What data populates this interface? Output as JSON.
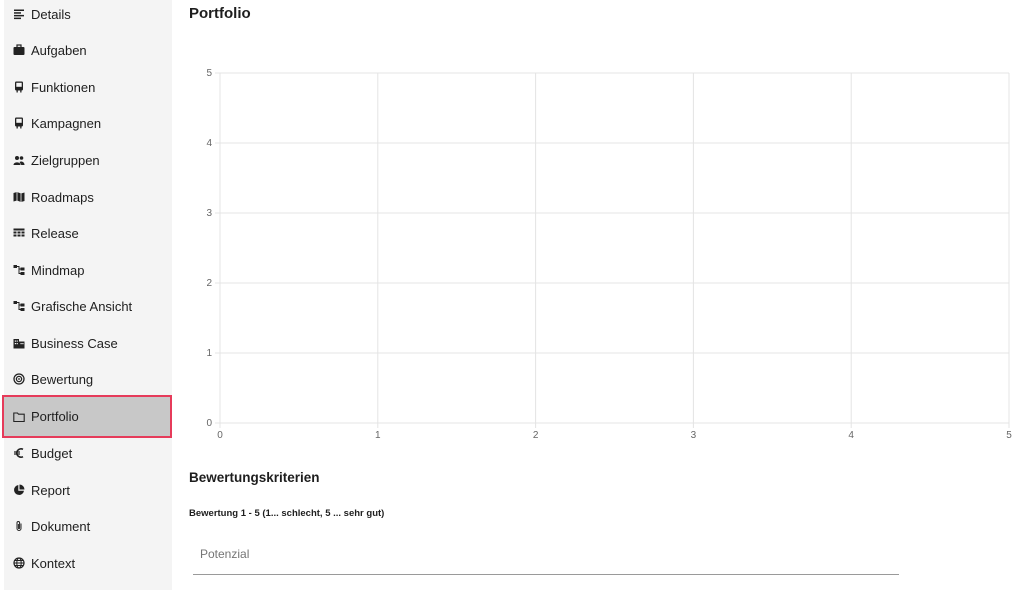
{
  "sidebar": {
    "items": [
      {
        "label": "Details",
        "icon": "details-icon"
      },
      {
        "label": "Aufgaben",
        "icon": "briefcase-icon"
      },
      {
        "label": "Funktionen",
        "icon": "device-icon"
      },
      {
        "label": "Kampagnen",
        "icon": "device-icon"
      },
      {
        "label": "Zielgruppen",
        "icon": "people-icon"
      },
      {
        "label": "Roadmaps",
        "icon": "map-icon"
      },
      {
        "label": "Release",
        "icon": "release-icon"
      },
      {
        "label": "Mindmap",
        "icon": "mindmap-icon"
      },
      {
        "label": "Grafische Ansicht",
        "icon": "mindmap-icon"
      },
      {
        "label": "Business Case",
        "icon": "building-icon"
      },
      {
        "label": "Bewertung",
        "icon": "target-icon"
      },
      {
        "label": "Portfolio",
        "icon": "folder-icon"
      },
      {
        "label": "Budget",
        "icon": "euro-icon"
      },
      {
        "label": "Report",
        "icon": "pie-chart-icon"
      },
      {
        "label": "Dokument",
        "icon": "paperclip-icon"
      },
      {
        "label": "Kontext",
        "icon": "globe-icon"
      }
    ],
    "active_index": 11,
    "active_border_color": "#e63b5a"
  },
  "main": {
    "title": "Portfolio",
    "section_title": "Bewertungskriterien",
    "rating_hint": "Bewertung 1 - 5 (1... schlecht, 5 ... sehr gut)",
    "criterion_field": {
      "placeholder": "Potenzial",
      "value": ""
    }
  },
  "chart_data": {
    "type": "scatter",
    "title": "",
    "xlabel": "",
    "ylabel": "",
    "xlim": [
      0,
      5
    ],
    "ylim": [
      0,
      5
    ],
    "x_ticks": [
      "0",
      "1",
      "2",
      "3",
      "4",
      "5"
    ],
    "y_ticks": [
      "0",
      "1",
      "2",
      "3",
      "4",
      "5"
    ],
    "grid": true,
    "series": []
  }
}
